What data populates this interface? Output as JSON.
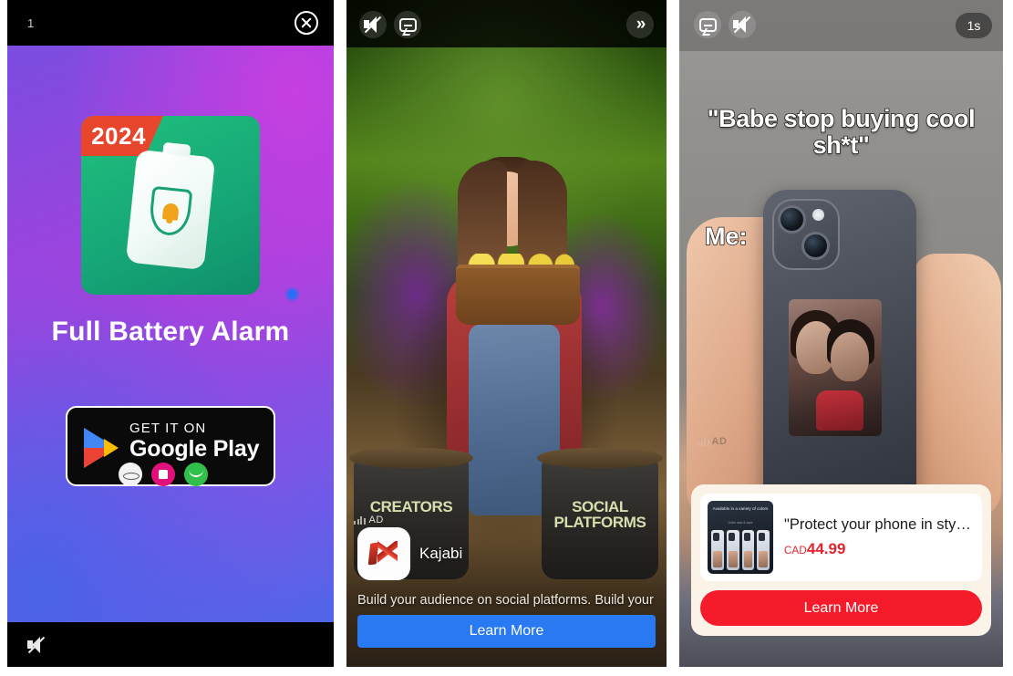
{
  "panels": [
    {
      "id": "panel-playable-ad",
      "topbar": {
        "counter": "1",
        "close_icon": "close-circle-icon"
      },
      "creative": {
        "badge_year": "2024",
        "app_title": "Full Battery Alarm",
        "store_button": {
          "eyebrow": "GET IT ON",
          "store": "Google Play",
          "oem_icons": [
            "samsung-icon",
            "xiaomi-icon",
            "oppo-icon"
          ]
        },
        "icons": [
          "battery-icon",
          "shield-icon",
          "bell-icon"
        ],
        "colors": {
          "bg_start": "#7b4de0",
          "bg_mid": "#a341dd",
          "bg_end": "#4f66e9",
          "icon_green": "#17a878",
          "badge_red": "#e8452d"
        }
      },
      "bottombar": {
        "mute_icon": "speaker-muted-icon"
      }
    },
    {
      "id": "panel-kajabi-ad",
      "topbar": {
        "mute_icon": "speaker-muted-icon",
        "caption_icon": "caption-bubble-icon",
        "skip_label": "»"
      },
      "scene": {
        "bucket_left_text": "CREATORS",
        "bucket_right_text": "SOCIAL PLATFORMS"
      },
      "ad": {
        "ad_label": "AD",
        "brand": "Kajabi",
        "description": "Build your audience on social platforms. Build your …",
        "cta_label": "Learn More",
        "cta_color": "#2979f2"
      }
    },
    {
      "id": "panel-phonecase-ad",
      "topbar": {
        "caption_icon": "caption-bubble-icon",
        "mute_icon": "speaker-muted-icon",
        "timer_label": "1s"
      },
      "meme": {
        "quote": "\"Babe stop buying cool sh*t\"",
        "reply": "Me:",
        "ad_watermark": "AD"
      },
      "product": {
        "thumb_headline": "Available in a variety of colors",
        "thumb_subline": "Order now & save",
        "title": "\"Protect your phone in sty…",
        "currency": "CAD",
        "price": "44.99",
        "price_color": "#e2242c",
        "cta_label": "Learn More",
        "cta_color": "#f51b2a",
        "card_bg": "#fbf3e7"
      }
    }
  ]
}
